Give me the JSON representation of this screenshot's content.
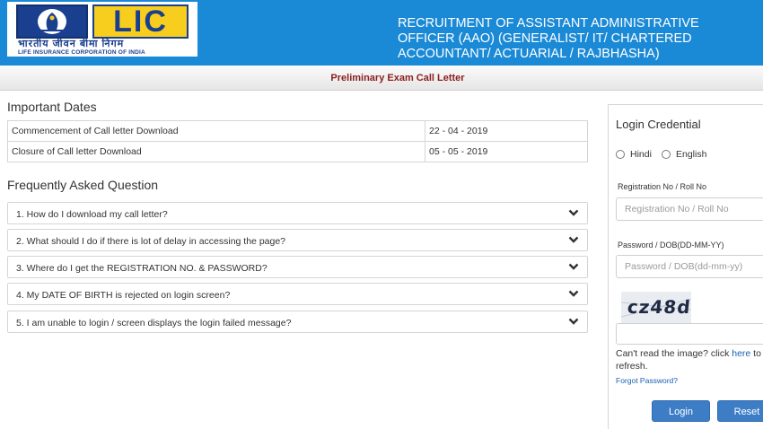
{
  "header": {
    "logo": {
      "brand": "LIC",
      "hindi_name": "भारतीय जीवन बीमा निगम",
      "english_name": "LIFE INSURANCE CORPORATION OF INDIA"
    },
    "title": "RECRUITMENT OF ASSISTANT ADMINISTRATIVE OFFICER (AAO) (GENERALIST/ IT/ CHARTERED ACCOUNTANT/ ACTUARIAL / RAJBHASHA)",
    "bg_color": "#1b8ad6"
  },
  "subbar": {
    "title": "Preliminary Exam Call Letter",
    "title_color": "#8b2020"
  },
  "important_dates": {
    "heading": "Important Dates",
    "rows": [
      {
        "label": "Commencement of Call letter Download",
        "value": "22 - 04 - 2019"
      },
      {
        "label": "Closure of Call letter Download",
        "value": "05 - 05 - 2019"
      }
    ]
  },
  "faq": {
    "heading": "Frequently Asked Question",
    "items": [
      {
        "label": "1. How do I download my call letter?",
        "icon": "chevron-down-icon"
      },
      {
        "label": "2. What should I do if there is lot of delay in accessing the page?",
        "icon": "chevron-down-icon"
      },
      {
        "label": "3. Where do I get the REGISTRATION NO. & PASSWORD?",
        "icon": "chevron-down-icon"
      },
      {
        "label": "4. My DATE OF BIRTH is rejected on login screen?",
        "icon": "chevron-down-icon"
      },
      {
        "label": "5. I am unable to login / screen displays the login failed message?",
        "icon": "chevron-down-icon"
      }
    ]
  },
  "login": {
    "title": "Login Credential",
    "languages": [
      "Hindi",
      "English"
    ],
    "registration": {
      "label": "Registration No / Roll No",
      "placeholder": "Registration No / Roll No"
    },
    "password": {
      "label": "Password / DOB(DD-MM-YY)",
      "placeholder": "Password / DOB(dd-mm-yy)"
    },
    "captcha_text": "cz48d",
    "cant_read_prefix": "Can't read the image? click ",
    "cant_read_link": "here",
    "cant_read_suffix": " to refresh.",
    "forgot_password": "Forgot Password?",
    "login_button": "Login",
    "reset_button": "Reset",
    "button_color": "#3d7dc6"
  }
}
